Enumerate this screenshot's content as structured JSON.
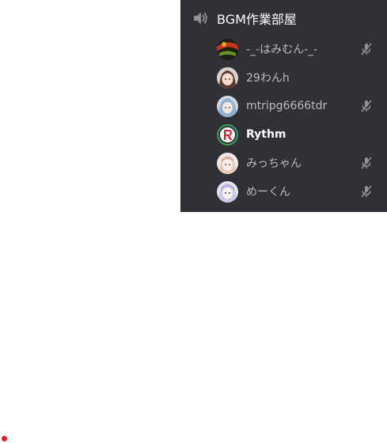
{
  "voice_channel": {
    "name": "BGM作業部屋",
    "icon": "speaker-icon"
  },
  "members": [
    {
      "name": "-_-はみむん-_-",
      "muted": true,
      "speaking": false,
      "avatar": "avatar-dark-green-red"
    },
    {
      "name": "29わんh",
      "muted": false,
      "speaking": false,
      "avatar": "avatar-anime-brown-hair"
    },
    {
      "name": "mtripg6666tdr",
      "muted": true,
      "speaking": false,
      "avatar": "avatar-anime-blue-hair"
    },
    {
      "name": "Rythm",
      "muted": false,
      "speaking": true,
      "avatar": "avatar-rythm-bot"
    },
    {
      "name": "みっちゃん",
      "muted": true,
      "speaking": false,
      "avatar": "avatar-anime-pink"
    },
    {
      "name": "めーくん",
      "muted": true,
      "speaking": false,
      "avatar": "avatar-anime-white-hair"
    }
  ],
  "colors": {
    "panel_bg": "#2f3136",
    "name_default": "#b9bbbe",
    "name_active": "#ffffff",
    "mute_icon": "#8e9297",
    "speaking_ring": "#3ba55c",
    "indicator_dot": "#e01e1e"
  }
}
